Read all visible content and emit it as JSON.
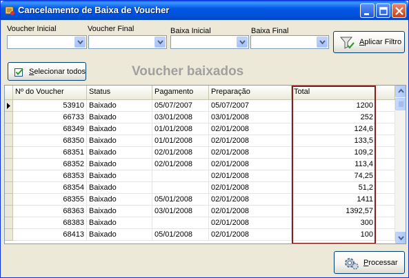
{
  "window": {
    "title": "Cancelamento de Baixa de Voucher"
  },
  "filters": {
    "voucher_inicial_label": "Voucher Inicial",
    "voucher_final_label": "Voucher Final",
    "baixa_inicial_label": "Baixa Inicial",
    "baixa_final_label": "Baixa Final",
    "voucher_inicial_value": "",
    "voucher_final_value": "",
    "baixa_inicial_value": "",
    "baixa_final_value": "",
    "apply_label": "Aplicar Filtro"
  },
  "select_all_label": "Selecionar todos",
  "heading": "Voucher baixados",
  "table": {
    "columns": [
      "Nº do Voucher",
      "Status",
      "Pagamento",
      "Preparação",
      "Total"
    ],
    "rows": [
      [
        "53910",
        "Baixado",
        "05/07/2007",
        "05/07/2007",
        "1200"
      ],
      [
        "66733",
        "Baixado",
        "03/01/2008",
        "03/01/2008",
        "252"
      ],
      [
        "68349",
        "Baixado",
        "01/01/2008",
        "02/01/2008",
        "124,6"
      ],
      [
        "68350",
        "Baixado",
        "01/01/2008",
        "02/01/2008",
        "133,5"
      ],
      [
        "68351",
        "Baixado",
        "02/01/2008",
        "02/01/2008",
        "109,2"
      ],
      [
        "68352",
        "Baixado",
        "02/01/2008",
        "02/01/2008",
        "113,4"
      ],
      [
        "68353",
        "Baixado",
        "",
        "02/01/2008",
        "74,25"
      ],
      [
        "68354",
        "Baixado",
        "",
        "02/01/2008",
        "51,2"
      ],
      [
        "68355",
        "Baixado",
        "05/01/2008",
        "02/01/2008",
        "1411"
      ],
      [
        "68363",
        "Baixado",
        "03/01/2008",
        "02/01/2008",
        "1392,57"
      ],
      [
        "68383",
        "Baixado",
        "",
        "02/01/2008",
        "300"
      ],
      [
        "68413",
        "Baixado",
        "05/01/2008",
        "02/01/2008",
        "100"
      ]
    ]
  },
  "process_label": "Processar",
  "colors": {
    "title_bar": "#0058E6",
    "highlight_border": "#8B1A1A",
    "heading": "#A0A0A0"
  }
}
